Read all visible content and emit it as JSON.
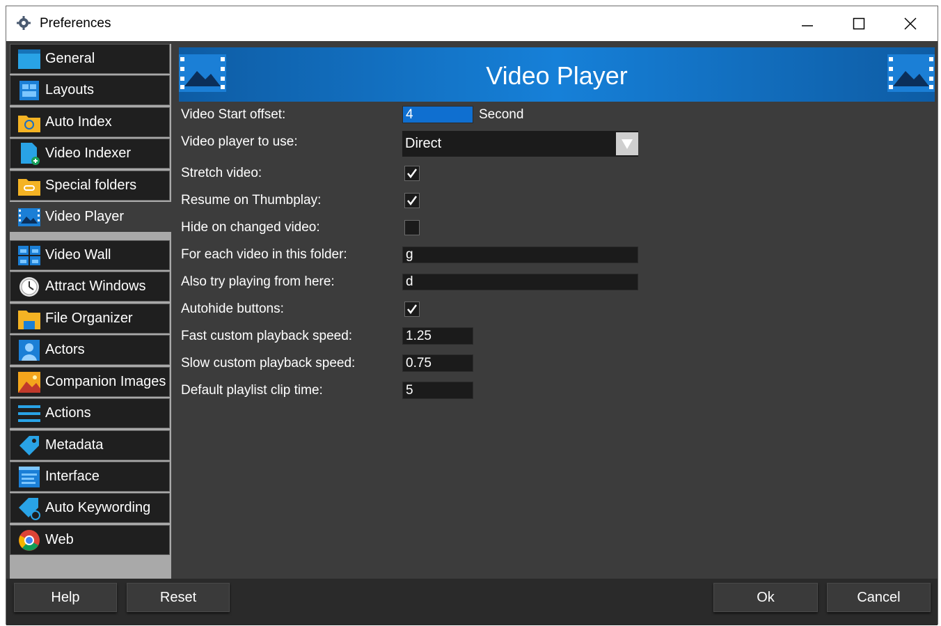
{
  "window": {
    "title": "Preferences"
  },
  "sidebar": {
    "items": [
      {
        "label": "General",
        "icon": "window-icon"
      },
      {
        "label": "Layouts",
        "icon": "layout-icon"
      },
      {
        "label": "Auto Index",
        "icon": "folder-sync-icon"
      },
      {
        "label": "Video Indexer",
        "icon": "file-add-icon"
      },
      {
        "label": "Special folders",
        "icon": "folder-link-icon"
      },
      {
        "label": "Video Player",
        "icon": "video-player-icon"
      },
      {
        "label": "Video Wall",
        "icon": "video-wall-icon"
      },
      {
        "label": "Attract Windows",
        "icon": "clock-icon"
      },
      {
        "label": "File Organizer",
        "icon": "folder-icon"
      },
      {
        "label": "Actors",
        "icon": "person-icon"
      },
      {
        "label": "Companion Images",
        "icon": "image-icon"
      },
      {
        "label": "Actions",
        "icon": "list-icon"
      },
      {
        "label": "Metadata",
        "icon": "tag-icon"
      },
      {
        "label": "Interface",
        "icon": "interface-icon"
      },
      {
        "label": "Auto Keywording",
        "icon": "tag-sync-icon"
      },
      {
        "label": "Web",
        "icon": "chrome-icon"
      }
    ],
    "active": "Video Player"
  },
  "panel": {
    "title": "Video Player",
    "rows": {
      "start_offset": {
        "label": "Video Start offset:",
        "value": "4",
        "unit": "Second"
      },
      "player": {
        "label": "Video player to use:",
        "value": "Direct"
      },
      "stretch": {
        "label": "Stretch video:",
        "checked": true
      },
      "resume": {
        "label": "Resume on Thumbplay:",
        "checked": true
      },
      "hide_changed": {
        "label": "Hide on changed video:",
        "checked": false
      },
      "for_each": {
        "label": "For each video in this folder:",
        "value": "g"
      },
      "also_try": {
        "label": "Also try playing from here:",
        "value": "d"
      },
      "autohide": {
        "label": "Autohide buttons:",
        "checked": true
      },
      "fast_speed": {
        "label": "Fast custom playback speed:",
        "value": "1.25"
      },
      "slow_speed": {
        "label": "Slow custom playback speed:",
        "value": "0.75"
      },
      "clip_time": {
        "label": "Default playlist clip time:",
        "value": "5"
      }
    }
  },
  "buttons": {
    "help": "Help",
    "reset": "Reset",
    "ok": "Ok",
    "cancel": "Cancel"
  },
  "colors": {
    "accent": "#1680d8",
    "selection": "#0f6fd0",
    "background": "#3c3c3c"
  }
}
